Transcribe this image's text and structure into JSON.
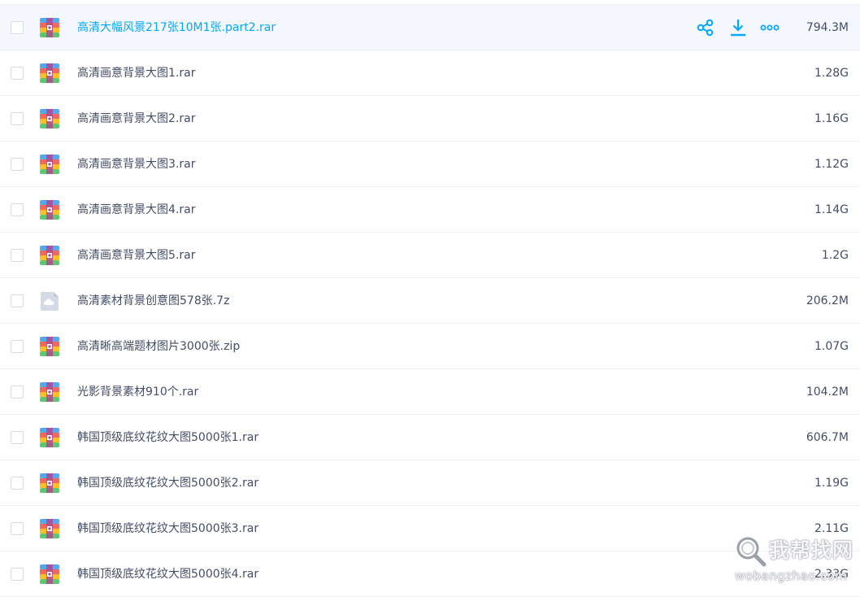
{
  "files": [
    {
      "name": "高清大幅风景217张10M1张.part2.rar",
      "size": "794.3M",
      "icon": "rar-archive-icon"
    },
    {
      "name": "高清画意背景大图1.rar",
      "size": "1.28G",
      "icon": "rar-archive-icon"
    },
    {
      "name": "高清画意背景大图2.rar",
      "size": "1.16G",
      "icon": "rar-archive-icon"
    },
    {
      "name": "高清画意背景大图3.rar",
      "size": "1.12G",
      "icon": "rar-archive-icon"
    },
    {
      "name": "高清画意背景大图4.rar",
      "size": "1.14G",
      "icon": "rar-archive-icon"
    },
    {
      "name": "高清画意背景大图5.rar",
      "size": "1.2G",
      "icon": "rar-archive-icon"
    },
    {
      "name": "高清素材背景创意图578张.7z",
      "size": "206.2M",
      "icon": "cloud-file-icon"
    },
    {
      "name": "高清晰高端题材图片3000张.zip",
      "size": "1.07G",
      "icon": "rar-archive-icon"
    },
    {
      "name": "光影背景素材910个.rar",
      "size": "104.2M",
      "icon": "rar-archive-icon"
    },
    {
      "name": "韩国顶级底纹花纹大图5000张1.rar",
      "size": "606.7M",
      "icon": "rar-archive-icon"
    },
    {
      "name": "韩国顶级底纹花纹大图5000张2.rar",
      "size": "1.19G",
      "icon": "rar-archive-icon"
    },
    {
      "name": "韩国顶级底纹花纹大图5000张3.rar",
      "size": "2.11G",
      "icon": "rar-archive-icon"
    },
    {
      "name": "韩国顶级底纹花纹大图5000张4.rar",
      "size": "2.33G",
      "icon": "rar-archive-icon"
    }
  ],
  "hover_actions": {
    "share_icon": "share-icon",
    "download_icon": "download-icon",
    "more_icon": "more-icon"
  },
  "colors": {
    "accent": "#06a7ff",
    "text": "#424e67",
    "hover_row": "#f4f8fe",
    "divider": "#eef0f6"
  },
  "watermark": {
    "text": "我帮找网",
    "url": "wobangzhao.com"
  }
}
